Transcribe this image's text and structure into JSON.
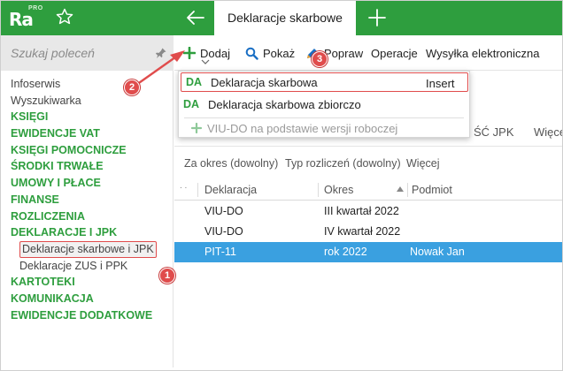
{
  "app": {
    "logo_text": "Ra",
    "logo_badge": "PRO",
    "active_tab": "Deklaracje skarbowe"
  },
  "sidebar": {
    "search_placeholder": "Szukaj poleceń",
    "items": [
      {
        "label": "Infoserwis",
        "kind": "plain"
      },
      {
        "label": "Wyszukiwarka",
        "kind": "plain"
      },
      {
        "label": "KSIĘGI",
        "kind": "section"
      },
      {
        "label": "EWIDENCJE VAT",
        "kind": "section"
      },
      {
        "label": "KSIĘGI POMOCNICZE",
        "kind": "section"
      },
      {
        "label": "ŚRODKI TRWAŁE",
        "kind": "section"
      },
      {
        "label": "UMOWY I PŁACE",
        "kind": "section"
      },
      {
        "label": "FINANSE",
        "kind": "section"
      },
      {
        "label": "ROZLICZENIA",
        "kind": "section"
      },
      {
        "label": "DEKLARACJE I JPK",
        "kind": "section"
      },
      {
        "label": "Deklaracje skarbowe i JPK",
        "kind": "sub"
      },
      {
        "label": "Deklaracje ZUS i PPK",
        "kind": "sub"
      },
      {
        "label": "KARTOTEKI",
        "kind": "section"
      },
      {
        "label": "KOMUNIKACJA",
        "kind": "section"
      },
      {
        "label": "EWIDENCJE DODATKOWE",
        "kind": "section"
      }
    ]
  },
  "toolbar": {
    "add": "Dodaj",
    "show": "Pokaż",
    "fix": "Popraw",
    "operations": "Operacje",
    "send": "Wysyłka elektroniczna"
  },
  "dropdown": {
    "items": [
      {
        "badge": "DA",
        "label": "Deklaracja skarbowa",
        "shortcut": "Insert"
      },
      {
        "badge": "DA",
        "label": "Deklaracja skarbowa zbiorczo",
        "shortcut": ""
      },
      {
        "badge": "",
        "label": "VIU-DO na podstawie wersji roboczej",
        "shortcut": ""
      }
    ]
  },
  "subtabs": {
    "partial_left": "ŚĆ JPK",
    "partial_right": "Więce"
  },
  "filters": {
    "period": "Za okres (dowolny)",
    "type": "Typ rozliczeń (dowolny)",
    "more": "Więcej"
  },
  "grid": {
    "row_marker": ". .",
    "columns": [
      "Deklaracja",
      "Okres",
      "Podmiot"
    ],
    "rows": [
      {
        "declaration": "VIU-DO",
        "period": "III kwartał 2022",
        "entity": ""
      },
      {
        "declaration": "VIU-DO",
        "period": "IV kwartał 2022",
        "entity": ""
      },
      {
        "declaration": "PIT-11",
        "period": "rok 2022",
        "entity": "Nowak Jan"
      }
    ]
  },
  "callouts": {
    "step1": "1",
    "step2": "2",
    "step3": "3"
  },
  "colors": {
    "brand_green": "#2e9e3e",
    "callout_red": "#e04c4c",
    "selection_blue": "#3aa0e0"
  }
}
